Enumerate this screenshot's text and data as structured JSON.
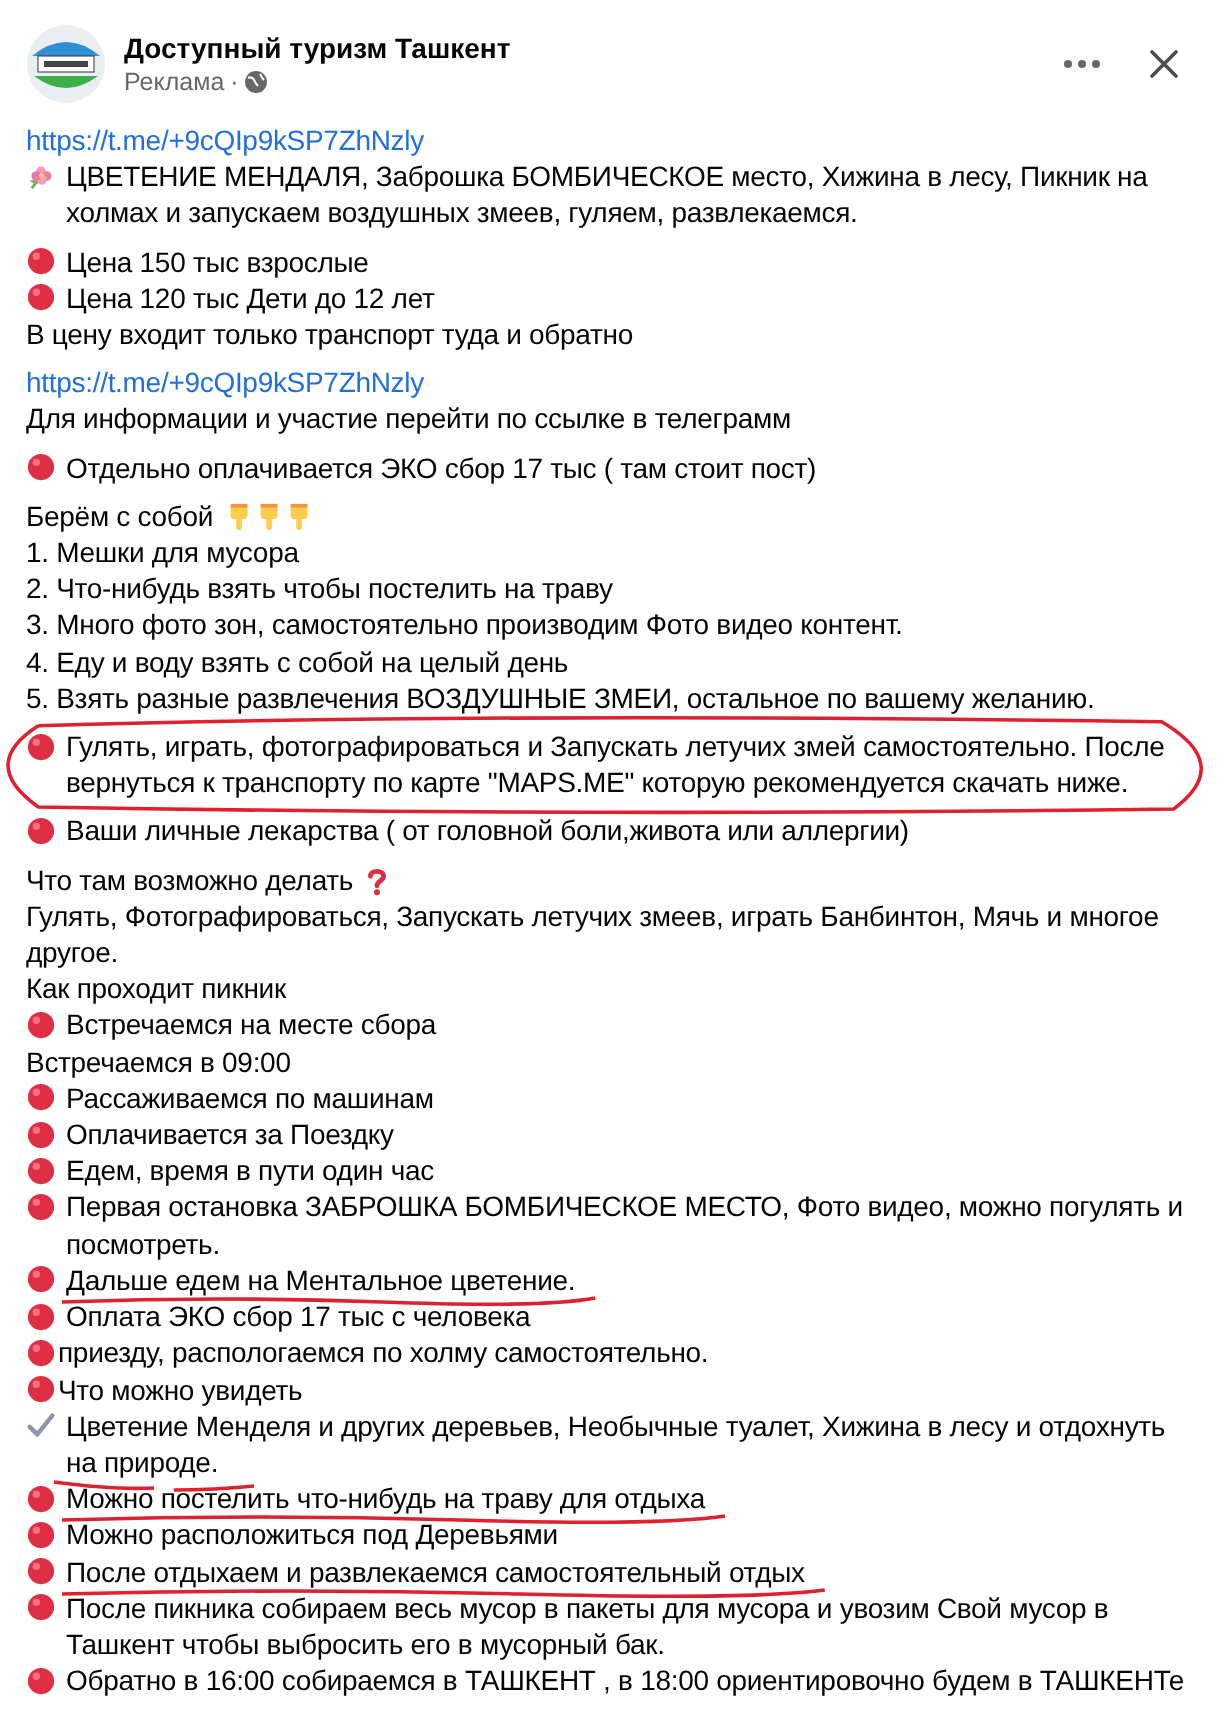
{
  "post": {
    "page_name": "Доступный туризм Ташкент",
    "sponsored": "Реклама",
    "separator": "·"
  },
  "blocks": [
    [
      {
        "kind": "link",
        "circled": false,
        "underlined": false,
        "text": "https://t.me/+9cQIp9kSP7ZhNzly"
      },
      {
        "kind": "flower",
        "circled": false,
        "underlined": false,
        "text": "ЦВЕТЕНИЕ МЕНДАЛЯ, Заброшка БОМБИЧЕСКОЕ место, Хижина в лесу, Пикник на холмах и запускаем воздушных змеев, гуляем, развлекаемся."
      }
    ],
    [
      {
        "kind": "dot",
        "circled": false,
        "underlined": false,
        "text": "Цена 150 тыс взрослые"
      },
      {
        "kind": "dot",
        "circled": false,
        "underlined": false,
        "text": "Цена 120 тыс Дети до 12 лет"
      },
      {
        "kind": "plain",
        "circled": false,
        "underlined": false,
        "text": "В цену входит только транспорт туда и обратно"
      }
    ],
    [
      {
        "kind": "link",
        "circled": false,
        "underlined": false,
        "text": "https://t.me/+9cQIp9kSP7ZhNzly"
      },
      {
        "kind": "plain",
        "circled": false,
        "underlined": false,
        "text": "Для информации и участие перейти по ссылке в телеграмм"
      }
    ],
    [
      {
        "kind": "dot",
        "circled": false,
        "underlined": false,
        "text": "Отдельно оплачивается ЭКО сбор 17 тыс ( там стоит пост)"
      }
    ],
    [
      {
        "kind": "hands",
        "circled": false,
        "underlined": false,
        "text": "Берём с собой"
      },
      {
        "kind": "plain",
        "circled": false,
        "underlined": false,
        "text": "1. Мешки для мусора"
      },
      {
        "kind": "plain",
        "circled": false,
        "underlined": false,
        "text": "2. Что-нибудь взять чтобы постелить на траву"
      },
      {
        "kind": "plain",
        "circled": false,
        "underlined": false,
        "text": "3. Много фото зон, самостоятельно производим Фото видео контент."
      },
      {
        "kind": "plain",
        "circled": false,
        "underlined": false,
        "text": "4. Еду и воду взять с собой на целый день"
      },
      {
        "kind": "plain",
        "circled": false,
        "underlined": false,
        "text": "5. Взять разные развлечения ВОЗДУШНЫЕ ЗМЕИ, остальное по вашему желанию."
      }
    ],
    [
      {
        "kind": "dot",
        "circled": true,
        "underlined": false,
        "text": "Гулять, играть, фотографироваться и Запускать летучих змей самостоятельно. После вернуться к транспорту по карте \"MAPS.ME\" которую рекомендуется скачать ниже."
      }
    ],
    [
      {
        "kind": "dot",
        "circled": false,
        "underlined": false,
        "text": "Ваши личные лекарства ( от головной боли,живота или аллергии)"
      }
    ],
    [
      {
        "kind": "question",
        "circled": false,
        "underlined": false,
        "text": "Что там возможно делать"
      },
      {
        "kind": "plain",
        "circled": false,
        "underlined": false,
        "text": "Гулять, Фотографироваться, Запускать летучих змеев, играть Банбинтон, Мячь и многое другое."
      },
      {
        "kind": "plain",
        "circled": false,
        "underlined": false,
        "text": "Как проходит пикник"
      },
      {
        "kind": "dot",
        "circled": false,
        "underlined": false,
        "text": "Встречаемся на месте сбора"
      },
      {
        "kind": "plain",
        "circled": false,
        "underlined": false,
        "text": "Встречаемся в 09:00"
      },
      {
        "kind": "dot",
        "circled": false,
        "underlined": false,
        "text": "Рассаживаемся по машинам"
      },
      {
        "kind": "dot",
        "circled": false,
        "underlined": false,
        "text": "Оплачивается за Поездку"
      },
      {
        "kind": "dot",
        "circled": false,
        "underlined": false,
        "text": "Едем, время в пути один час"
      },
      {
        "kind": "dot",
        "circled": false,
        "underlined": false,
        "text": "Первая остановка ЗАБРОШКА БОМБИЧЕСКОЕ МЕСТО, Фото видео, можно погулять и посмотреть."
      },
      {
        "kind": "dot",
        "circled": false,
        "underlined": true,
        "text": "Дальше едем на Ментальное цветение."
      },
      {
        "kind": "dot",
        "circled": false,
        "underlined": false,
        "text": "Оплата ЭКО сбор 17 тыс с человека"
      },
      {
        "kind": "dot_tight",
        "circled": false,
        "underlined": false,
        "text": "приезду, распологаемся по холму самостоятельно."
      },
      {
        "kind": "dot_tight",
        "circled": false,
        "underlined": false,
        "text": "Что можно увидеть"
      },
      {
        "kind": "check",
        "circled": false,
        "underlined": true,
        "text": "Цветение Менделя и других деревьев, Необычные туалет, Хижина в лесу и отдохнуть на природе."
      },
      {
        "kind": "dot",
        "circled": false,
        "underlined": true,
        "text": "Можно постелить что-нибудь на траву для отдыха"
      },
      {
        "kind": "dot",
        "circled": false,
        "underlined": false,
        "text": "Можно расположиться под Деревьями"
      },
      {
        "kind": "dot",
        "circled": false,
        "underlined": true,
        "text": "После отдыхаем и развлекаемся самостоятельный отдых"
      },
      {
        "kind": "dot",
        "circled": false,
        "underlined": false,
        "text": "После пикника собираем весь мусор в пакеты для мусора и увозим Свой мусор в Ташкент чтобы выбросить его в мусорный бак."
      },
      {
        "kind": "dot",
        "circled": false,
        "underlined": false,
        "text": "Обратно в 16:00 собираемся в ТАШКЕНТ , в 18:00 ориентировочно будем в ТАШКЕНТе"
      }
    ]
  ]
}
